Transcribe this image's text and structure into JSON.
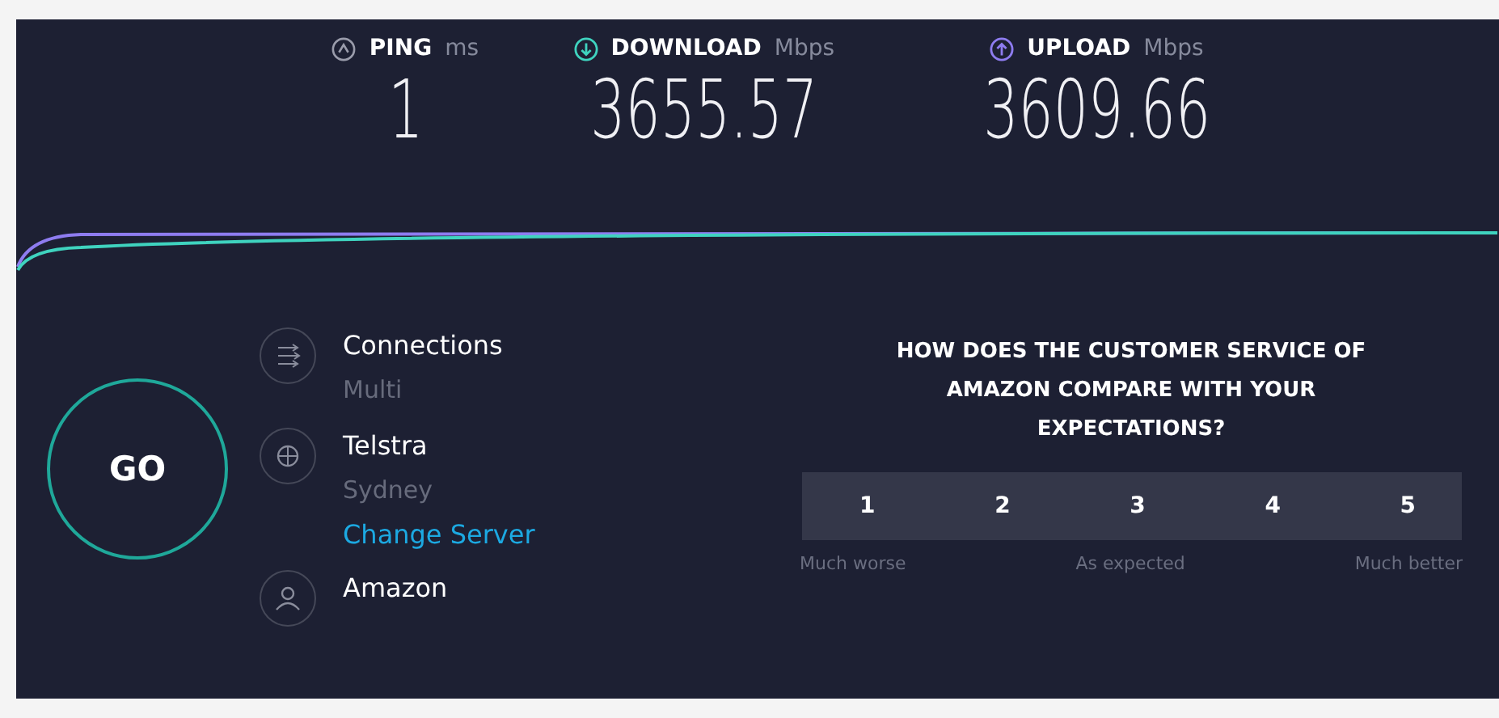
{
  "metrics": [
    {
      "kind": "ping",
      "label": "PING",
      "unit": "ms",
      "value": "1"
    },
    {
      "kind": "download",
      "label": "DOWNLOAD",
      "unit": "Mbps",
      "value": "3655.57"
    },
    {
      "kind": "upload",
      "label": "UPLOAD",
      "unit": "Mbps",
      "value": "3609.66"
    }
  ],
  "go_button": "GO",
  "info": [
    {
      "kind": "connections",
      "title": "Connections",
      "subtitle": "Multi"
    },
    {
      "kind": "isp",
      "title": "Telstra",
      "subtitle": "Sydney",
      "link": "Change Server"
    },
    {
      "kind": "host",
      "title": "Amazon"
    }
  ],
  "survey": {
    "question": "HOW DOES THE CUSTOMER SERVICE OF AMAZON COMPARE WITH YOUR EXPECTATIONS?",
    "options": [
      "1",
      "2",
      "3",
      "4",
      "5"
    ],
    "scale_labels": [
      "Much worse",
      "As expected",
      "Much better"
    ]
  }
}
